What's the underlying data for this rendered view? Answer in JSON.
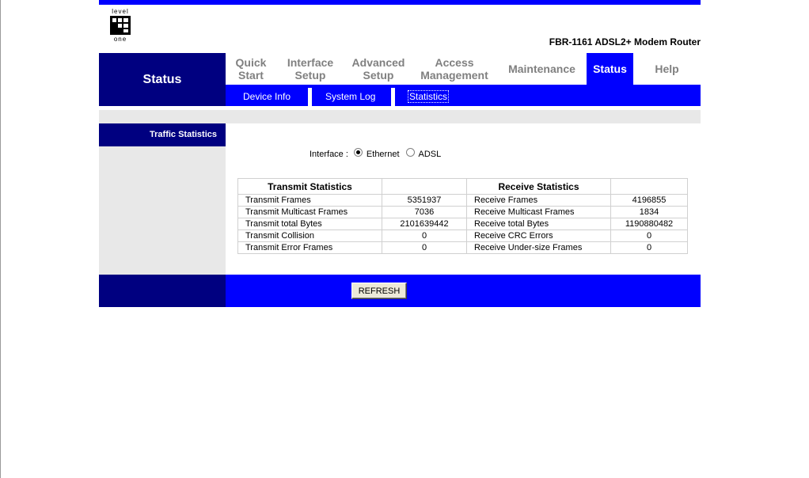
{
  "brand": {
    "logo_top": "level",
    "logo_bottom": "one"
  },
  "header": {
    "model": "FBR-1161 ADSL2+ Modem Router"
  },
  "left": {
    "section_title": "Status",
    "subsection_title": "Traffic Statistics"
  },
  "nav": {
    "items": [
      {
        "line1": "Quick",
        "line2": "Start"
      },
      {
        "line1": "Interface",
        "line2": "Setup"
      },
      {
        "line1": "Advanced",
        "line2": "Setup"
      },
      {
        "line1": "Access",
        "line2": "Management"
      },
      {
        "line1": "Maintenance",
        "line2": ""
      },
      {
        "line1": "Status",
        "line2": ""
      },
      {
        "line1": "Help",
        "line2": ""
      }
    ],
    "active": "Status"
  },
  "subnav": {
    "items": [
      "Device Info",
      "System Log",
      "Statistics"
    ],
    "selected": "Statistics"
  },
  "interface": {
    "label": "Interface :",
    "options": [
      "Ethernet",
      "ADSL"
    ],
    "selected": "Ethernet"
  },
  "stats": {
    "transmit_header": "Transmit Statistics",
    "receive_header": "Receive Statistics",
    "rows": [
      {
        "tx_label": "Transmit Frames",
        "tx_value": "5351937",
        "rx_label": "Receive Frames",
        "rx_value": "4196855"
      },
      {
        "tx_label": "Transmit Multicast Frames",
        "tx_value": "7036",
        "rx_label": "Receive Multicast Frames",
        "rx_value": "1834"
      },
      {
        "tx_label": "Transmit total Bytes",
        "tx_value": "2101639442",
        "rx_label": "Receive total Bytes",
        "rx_value": "1190880482"
      },
      {
        "tx_label": "Transmit Collision",
        "tx_value": "0",
        "rx_label": "Receive CRC Errors",
        "rx_value": "0"
      },
      {
        "tx_label": "Transmit Error Frames",
        "tx_value": "0",
        "rx_label": "Receive Under-size Frames",
        "rx_value": "0"
      }
    ]
  },
  "actions": {
    "refresh_label": "REFRESH"
  },
  "colors": {
    "blue": "#0000ff",
    "navy": "#000080",
    "gray": "#e8e8e8",
    "nav_text": "#808080"
  }
}
